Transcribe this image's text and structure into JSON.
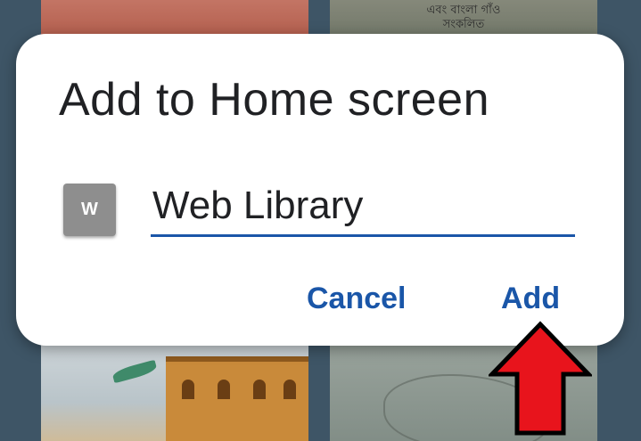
{
  "background": {
    "tile_top_right_text_line1": "এবং বাংলা গাঁও",
    "tile_top_right_text_line2": "সংকলিত"
  },
  "dialog": {
    "title": "Add to Home screen",
    "icon_letter": "W",
    "name_value": "Web Library",
    "cancel_label": "Cancel",
    "add_label": "Add"
  },
  "colors": {
    "accent": "#1a56a8",
    "icon_bg": "#8e8e8e",
    "arrow_fill": "#e8141c"
  },
  "icons": {
    "app_icon": "web-library-app-icon",
    "pointer": "red-up-arrow-icon"
  }
}
